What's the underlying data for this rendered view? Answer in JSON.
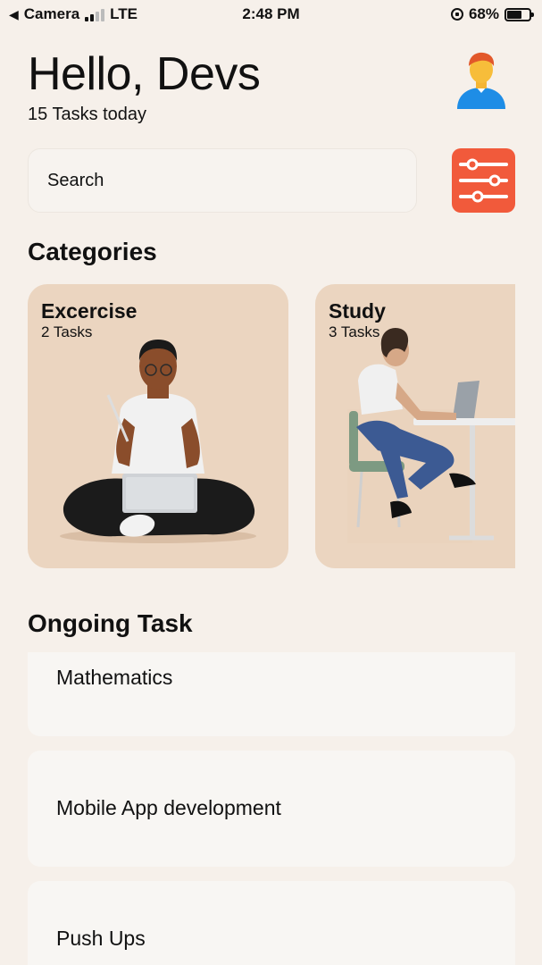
{
  "status_bar": {
    "back_label": "Camera",
    "network": "LTE",
    "time": "2:48 PM",
    "battery": "68%",
    "battery_level": 0.68
  },
  "header": {
    "greeting": "Hello, Devs",
    "subtitle": "15 Tasks today",
    "avatar_icon": "person-avatar-icon"
  },
  "search": {
    "placeholder": "Search",
    "filter_icon": "sliders-icon",
    "filter_color": "#f15a3b"
  },
  "categories": {
    "title": "Categories",
    "items": [
      {
        "title": "Excercise",
        "count": "2 Tasks"
      },
      {
        "title": "Study",
        "count": "3 Tasks"
      }
    ],
    "card_color": "#ebd5c0"
  },
  "ongoing": {
    "title": "Ongoing Task",
    "tasks": [
      {
        "label": "Mathematics"
      },
      {
        "label": "Mobile App development"
      },
      {
        "label": "Push Ups"
      }
    ]
  }
}
